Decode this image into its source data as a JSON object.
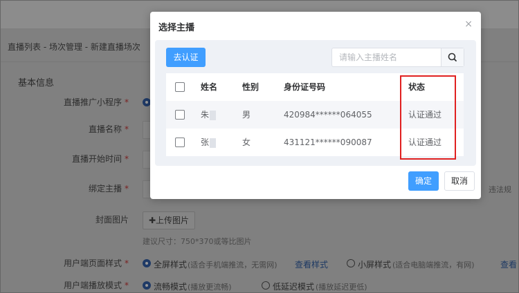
{
  "background": {
    "breadcrumb": "直播列表 - 场次管理 - 新建直播场次",
    "section_title": "基本信息",
    "fields": {
      "mini_program": "直播推广小程序",
      "live_name": "直播名称",
      "start_time": "直播开始时间",
      "anchor": "绑定主播",
      "cover": "封面图片",
      "page_style": "用户端页面样式",
      "play_mode": "用户端播放模式"
    },
    "required_mark": "*",
    "upload_button": "✚上传图片",
    "cover_hint": "建议尺寸：750*370或等比图片",
    "style_option1": "全屏样式",
    "style_option1_note": "(适合手机端推流，无需网)",
    "view_style_link": "查看样式",
    "style_option2": "小屏样式",
    "style_option2_note": "(适合电脑端推流，有网)",
    "view_style_link2": "查看",
    "play_option1": "流畅模式",
    "play_option1_note": "(播放更流畅)",
    "play_option2": "低延迟模式",
    "play_option2_note": "(播放延迟更低)",
    "rules_link": "违法规"
  },
  "dialog": {
    "title": "选择主播",
    "close_icon": "×",
    "auth_button": "去认证",
    "search_placeholder": "请输入主播姓名",
    "columns": {
      "name": "姓名",
      "gender": "性别",
      "id_number": "身份证号码",
      "status": "状态"
    },
    "rows": [
      {
        "name": "朱",
        "gender": "男",
        "id_number": "420984******064055",
        "status": "认证通过"
      },
      {
        "name": "张",
        "gender": "女",
        "id_number": "431121******090087",
        "status": "认证通过"
      }
    ],
    "confirm_button": "确定",
    "cancel_button": "取消"
  },
  "colors": {
    "primary": "#409eff",
    "highlight_box": "#e02020",
    "overlay": "#808080"
  }
}
